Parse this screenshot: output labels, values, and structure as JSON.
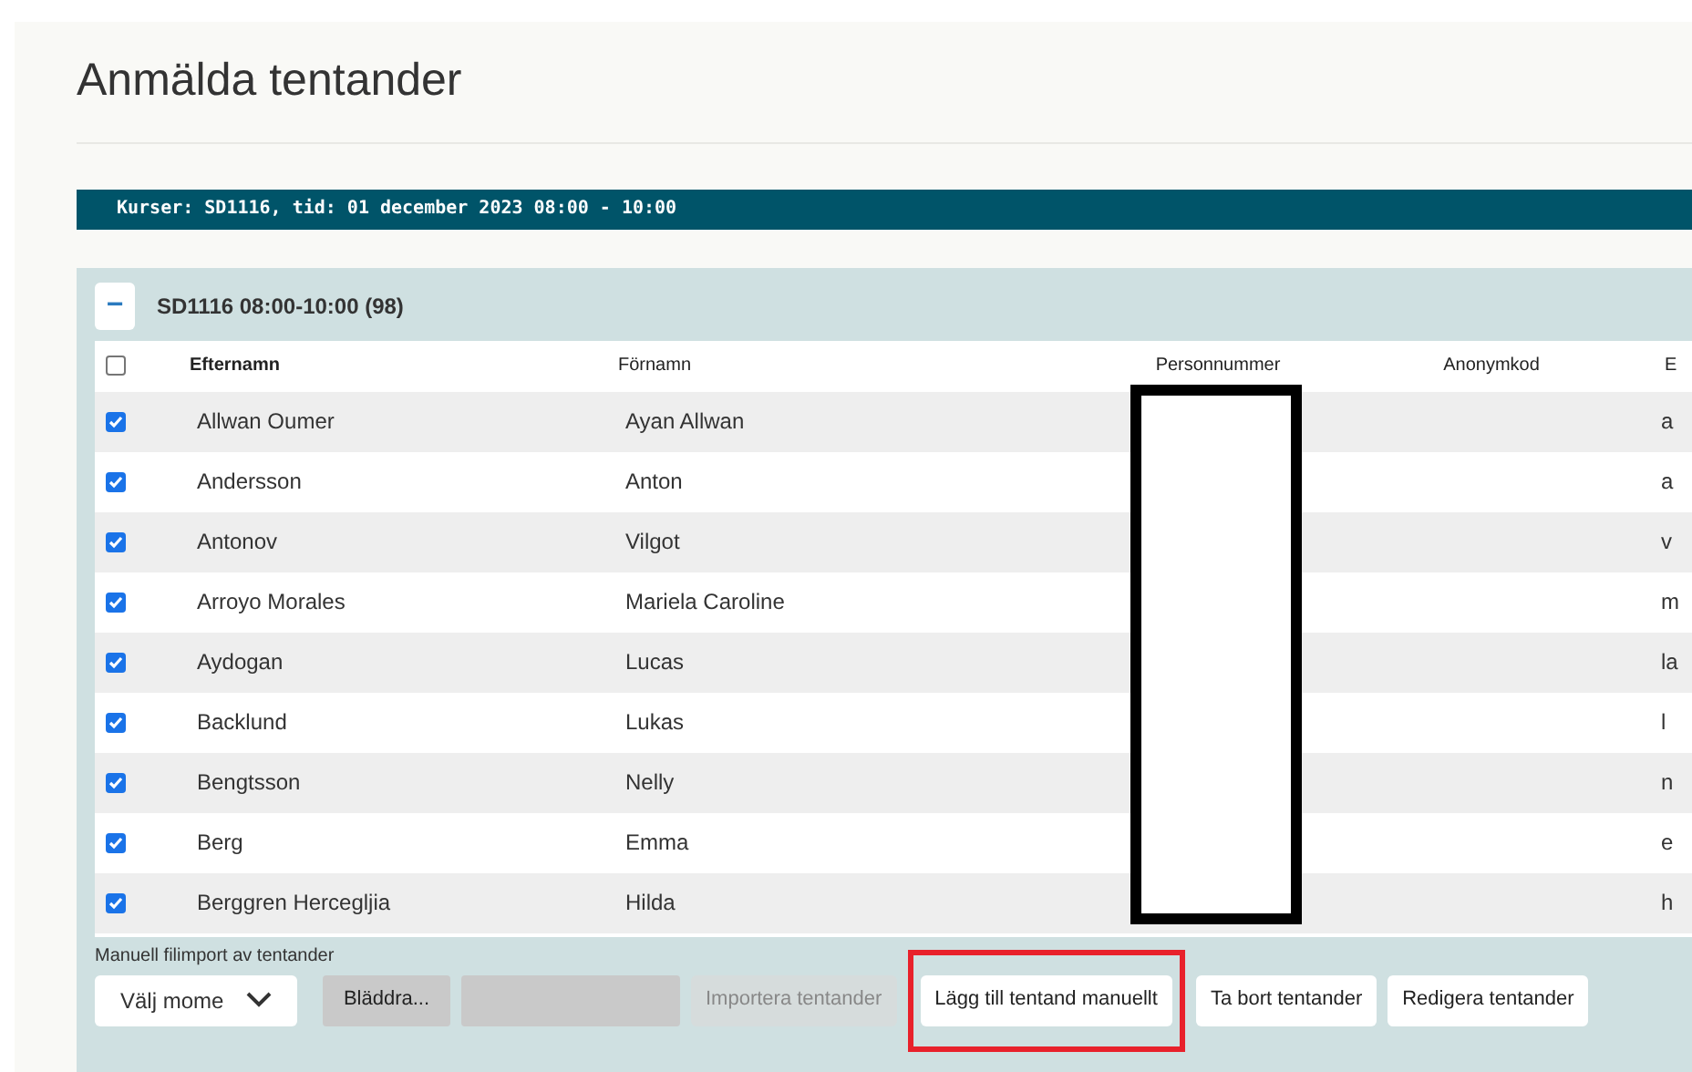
{
  "page_title": "Anmälda tentander",
  "course_bar": "Kurser: SD1116, tid: 01 december 2023 08:00 - 10:00",
  "group": {
    "title": "SD1116 08:00-10:00 (98)",
    "expanded": true,
    "collapse_symbol": "−"
  },
  "table": {
    "select_all_checked": false,
    "columns": [
      "Efternamn",
      "Förnamn",
      "Personnummer",
      "Anonymkod",
      "E"
    ],
    "rows": [
      {
        "checked": true,
        "cells": [
          "Allwan Oumer",
          "Ayan Allwan",
          "",
          "",
          "a"
        ]
      },
      {
        "checked": true,
        "cells": [
          "Andersson",
          "Anton",
          "",
          "",
          "a"
        ]
      },
      {
        "checked": true,
        "cells": [
          "Antonov",
          "Vilgot",
          "",
          "",
          "v"
        ]
      },
      {
        "checked": true,
        "cells": [
          "Arroyo Morales",
          "Mariela Caroline",
          "",
          "",
          "m"
        ]
      },
      {
        "checked": true,
        "cells": [
          "Aydogan",
          "Lucas",
          "",
          "",
          "la"
        ]
      },
      {
        "checked": true,
        "cells": [
          "Backlund",
          "Lukas",
          "",
          "",
          "l"
        ]
      },
      {
        "checked": true,
        "cells": [
          "Bengtsson",
          "Nelly",
          "",
          "",
          "n"
        ]
      },
      {
        "checked": true,
        "cells": [
          "Berg",
          "Emma",
          "",
          "",
          "e"
        ]
      },
      {
        "checked": true,
        "cells": [
          "Berggren Hercegljia",
          "Hilda",
          "",
          "",
          "h"
        ]
      }
    ]
  },
  "import_label": "Manuell filimport av tentander",
  "moment_select": {
    "value": "Välj mome"
  },
  "browse_button": "Bläddra...",
  "buttons": [
    {
      "label": "Importera tentander",
      "disabled": true
    },
    {
      "label": "Lägg till tentand manuellt",
      "disabled": false,
      "highlighted": true
    },
    {
      "label": "Ta bort tentander",
      "disabled": false
    },
    {
      "label": "Redigera tentander",
      "disabled": false
    }
  ]
}
